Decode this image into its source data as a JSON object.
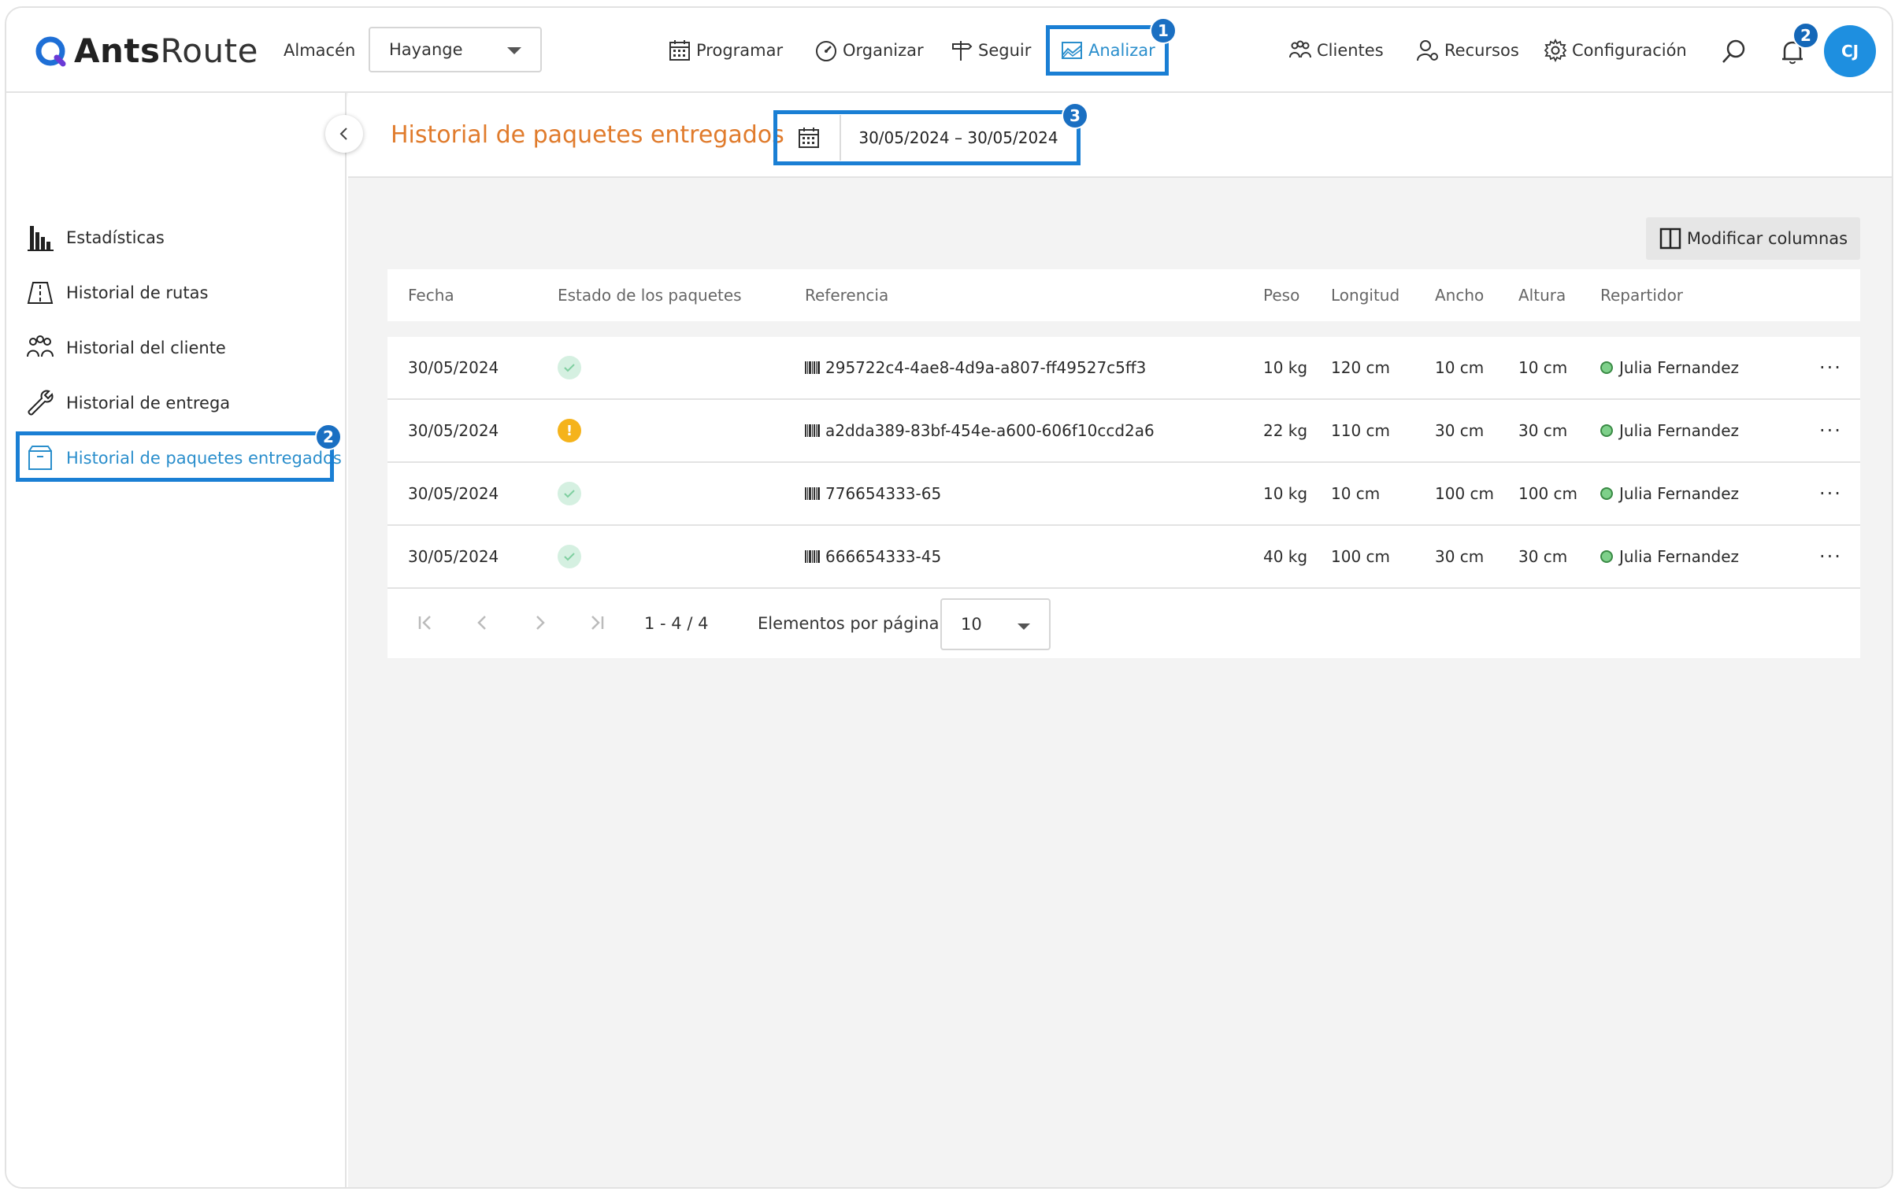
{
  "app": {
    "logo_light": "Ants",
    "logo_bold": "Route"
  },
  "header": {
    "warehouse_label": "Almacén",
    "warehouse_value": "Hayange",
    "nav": {
      "programar": "Programar",
      "organizar": "Organizar",
      "seguir": "Seguir",
      "analizar": "Analizar",
      "clientes": "Clientes",
      "recursos": "Recursos",
      "configuracion": "Configuración"
    },
    "notifications_count": "2",
    "avatar_initials": "CJ"
  },
  "annotations": {
    "badge_1": "1",
    "badge_2": "2",
    "badge_3": "3"
  },
  "sidebar": {
    "items": [
      {
        "label": "Estadísticas"
      },
      {
        "label": "Historial de rutas"
      },
      {
        "label": "Historial del cliente"
      },
      {
        "label": "Historial de entrega"
      },
      {
        "label": "Historial de paquetes entregados"
      }
    ]
  },
  "page": {
    "title": "Historial de paquetes entregados",
    "date_range": "30/05/2024 – 30/05/2024",
    "modify_columns": "Modificar columnas"
  },
  "table": {
    "headers": {
      "fecha": "Fecha",
      "estado": "Estado de los paquetes",
      "referencia": "Referencia",
      "peso": "Peso",
      "longitud": "Longitud",
      "ancho": "Ancho",
      "altura": "Altura",
      "repartidor": "Repartidor"
    },
    "rows": [
      {
        "fecha": "30/05/2024",
        "status": "ok",
        "referencia": "295722c4-4ae8-4d9a-a807-ff49527c5ff3",
        "peso": "10 kg",
        "longitud": "120 cm",
        "ancho": "10 cm",
        "altura": "10 cm",
        "repartidor": "Julia Fernandez",
        "more": "···"
      },
      {
        "fecha": "30/05/2024",
        "status": "warn",
        "status_glyph": "!",
        "referencia": "a2dda389-83bf-454e-a600-606f10ccd2a6",
        "peso": "22 kg",
        "longitud": "110 cm",
        "ancho": "30 cm",
        "altura": "30 cm",
        "repartidor": "Julia Fernandez",
        "more": "···"
      },
      {
        "fecha": "30/05/2024",
        "status": "ok",
        "referencia": "776654333-65",
        "peso": "10 kg",
        "longitud": "10 cm",
        "ancho": "100 cm",
        "altura": "100 cm",
        "repartidor": "Julia Fernandez",
        "more": "···"
      },
      {
        "fecha": "30/05/2024",
        "status": "ok",
        "referencia": "666654333-45",
        "peso": "40 kg",
        "longitud": "100 cm",
        "ancho": "30 cm",
        "altura": "30 cm",
        "repartidor": "Julia Fernandez",
        "more": "···"
      }
    ]
  },
  "pagination": {
    "range": "1 - 4 / 4",
    "per_page_label": "Elementos por página",
    "per_page_value": "10"
  }
}
